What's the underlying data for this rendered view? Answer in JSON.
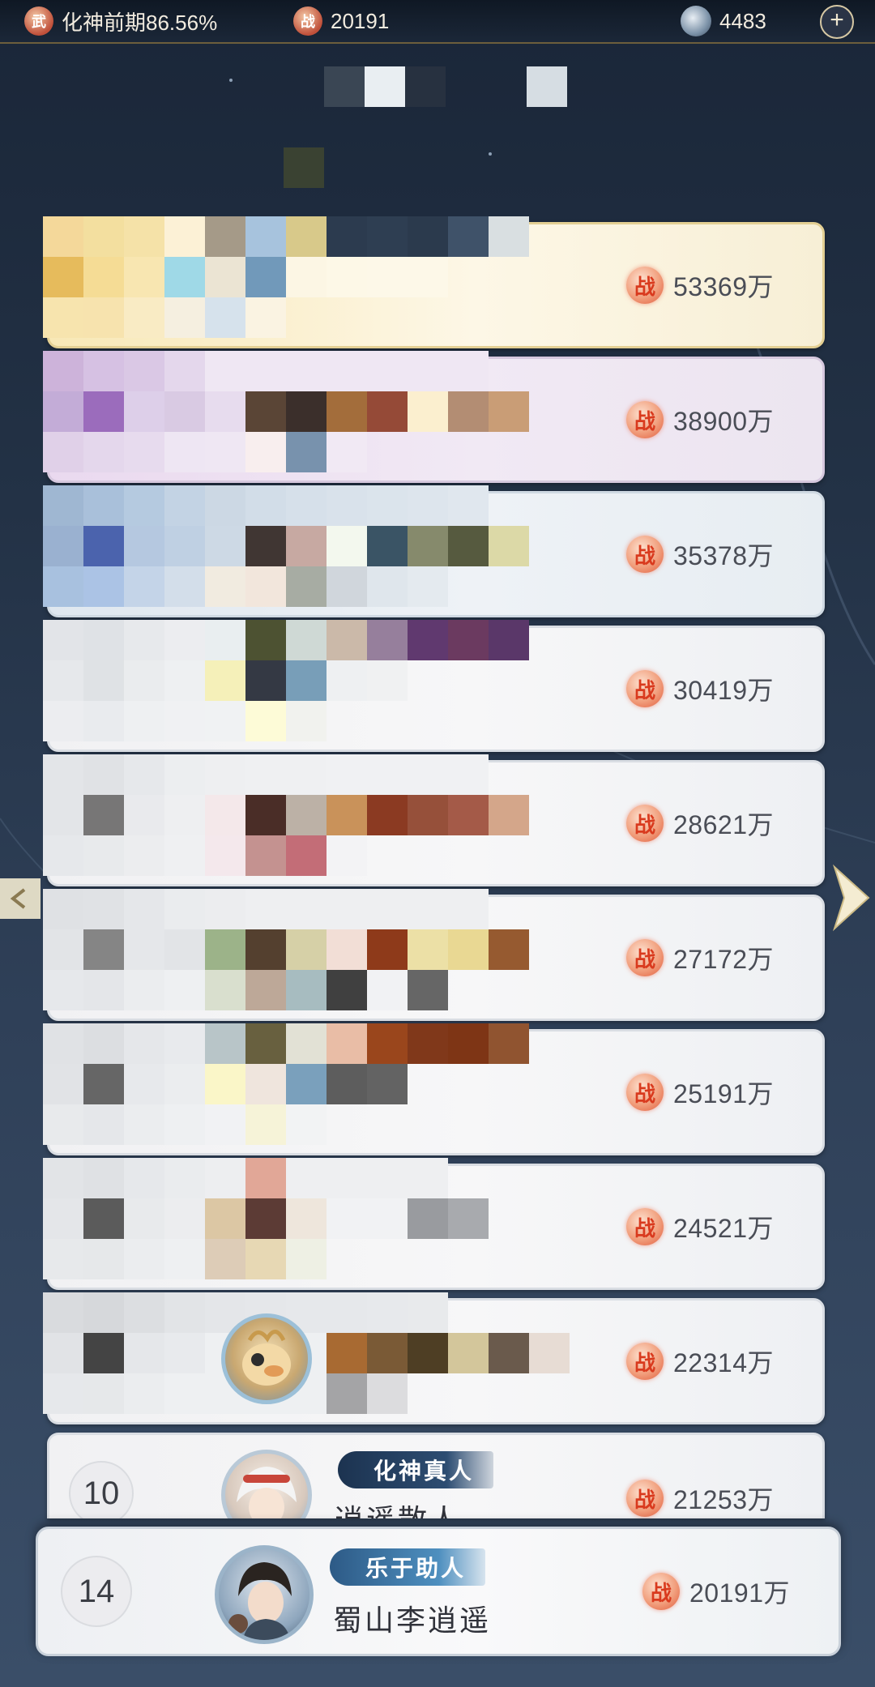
{
  "top_bar": {
    "realm_badge": "武",
    "realm_text": "化神前期86.56%",
    "power_badge": "战",
    "power_value": "20191",
    "stone_value": "4483",
    "add_button": "+"
  },
  "power_badge": "战",
  "ranking": [
    {
      "power": "53369万"
    },
    {
      "power": "38900万"
    },
    {
      "power": "35378万"
    },
    {
      "power": "30419万"
    },
    {
      "power": "28621万"
    },
    {
      "power": "27172万"
    },
    {
      "power": "25191万"
    },
    {
      "power": "24521万"
    },
    {
      "power": "22314万"
    },
    {
      "rank": "10",
      "title": "化神真人",
      "name": "逍遥散人",
      "power": "21253万"
    }
  ],
  "my_entry": {
    "rank": "14",
    "title": "乐于助人",
    "name": "蜀山李逍遥",
    "power": "20191万"
  },
  "colors": {
    "gold_row": "#fdf7e6",
    "purple_row": "#f1e9f4",
    "blue_row": "#eef2f6",
    "power_badge": "#e15a3b",
    "title_tag": "#27466a"
  }
}
